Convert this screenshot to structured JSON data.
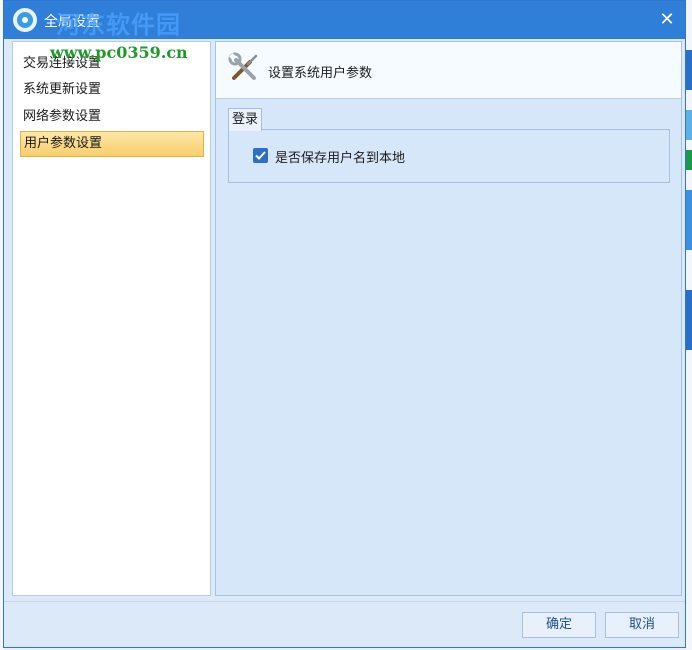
{
  "dialog": {
    "title": "全局设置",
    "close_symbol": "✕",
    "watermark_text": "河东软件园",
    "watermark_url": "www.pc0359.cn"
  },
  "nav": {
    "items": [
      {
        "label": "交易连接设置",
        "selected": false
      },
      {
        "label": "系统更新设置",
        "selected": false
      },
      {
        "label": "网络参数设置",
        "selected": false
      },
      {
        "label": "用户参数设置",
        "selected": true
      }
    ]
  },
  "content": {
    "icon": "tools-icon",
    "title": "设置系统用户参数",
    "group": {
      "label": "登录",
      "checkbox": {
        "label": "是否保存用户名到本地",
        "checked": true
      }
    }
  },
  "footer": {
    "ok_label": "确定",
    "cancel_label": "取消"
  },
  "colors": {
    "titlebar": "#2f7ed8",
    "selected_item": "#f8cf6b",
    "content_bg": "#d7e7fa"
  }
}
